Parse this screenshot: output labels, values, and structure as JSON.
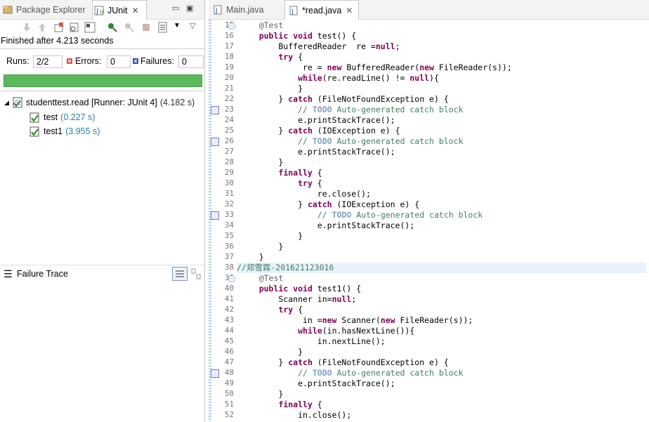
{
  "left_panel": {
    "tabs": [
      {
        "label": "Package Explorer"
      },
      {
        "label": "JUnit"
      }
    ],
    "finished_text": "Finished after 4.213 seconds",
    "runs_label": "Runs:",
    "runs_value": "2/2",
    "errors_label": "Errors:",
    "errors_value": "0",
    "failures_label": "Failures:",
    "failures_value": "0",
    "progress_fraction": 1.0,
    "progress_color": "#5cb85c",
    "suite": {
      "name": "studenttest.read [Runner: JUnit 4]",
      "time": "(4.182 s)"
    },
    "tests": [
      {
        "name": "test",
        "time": "(0.227 s)"
      },
      {
        "name": "test1",
        "time": "(3.955 s)"
      }
    ],
    "failure_trace_label": "Failure Trace"
  },
  "editor": {
    "tabs": [
      {
        "label": "Main.java"
      },
      {
        "label": "*read.java"
      }
    ],
    "lines": [
      {
        "n": "15",
        "text": "    @Test"
      },
      {
        "n": "16",
        "text": "    public void test() {"
      },
      {
        "n": "17",
        "text": "        BufferedReader  re =null;"
      },
      {
        "n": "18",
        "text": "        try {"
      },
      {
        "n": "19",
        "text": "             re = new BufferedReader(new FileReader(s));"
      },
      {
        "n": "20",
        "text": "            while(re.readLine() != null){"
      },
      {
        "n": "21",
        "text": "            }"
      },
      {
        "n": "22",
        "text": "        } catch (FileNotFoundException e) {"
      },
      {
        "n": "23",
        "text": "            // TODO Auto-generated catch block"
      },
      {
        "n": "24",
        "text": "            e.printStackTrace();"
      },
      {
        "n": "25",
        "text": "        } catch (IOException e) {"
      },
      {
        "n": "26",
        "text": "            // TODO Auto-generated catch block"
      },
      {
        "n": "27",
        "text": "            e.printStackTrace();"
      },
      {
        "n": "28",
        "text": "        }"
      },
      {
        "n": "29",
        "text": "        finally {"
      },
      {
        "n": "30",
        "text": "            try {"
      },
      {
        "n": "31",
        "text": "                re.close();"
      },
      {
        "n": "32",
        "text": "            } catch (IOException e) {"
      },
      {
        "n": "33",
        "text": "                // TODO Auto-generated catch block"
      },
      {
        "n": "34",
        "text": "                e.printStackTrace();"
      },
      {
        "n": "35",
        "text": "            }"
      },
      {
        "n": "36",
        "text": "        }"
      },
      {
        "n": "37",
        "text": "    }"
      },
      {
        "n": "38",
        "text": "//郑雪霖-201621123016"
      },
      {
        "n": "39",
        "text": "    @Test"
      },
      {
        "n": "40",
        "text": "    public void test1() {"
      },
      {
        "n": "41",
        "text": "        Scanner in=null;"
      },
      {
        "n": "42",
        "text": "        try {"
      },
      {
        "n": "43",
        "text": "             in =new Scanner(new FileReader(s));"
      },
      {
        "n": "44",
        "text": "            while(in.hasNextLine()){"
      },
      {
        "n": "45",
        "text": "                in.nextLine();"
      },
      {
        "n": "46",
        "text": "            }"
      },
      {
        "n": "47",
        "text": "        } catch (FileNotFoundException e) {"
      },
      {
        "n": "48",
        "text": "            // TODO Auto-generated catch block"
      },
      {
        "n": "49",
        "text": "            e.printStackTrace();"
      },
      {
        "n": "50",
        "text": "        }"
      },
      {
        "n": "51",
        "text": "        finally {"
      },
      {
        "n": "52",
        "text": "            in.close();"
      }
    ]
  }
}
